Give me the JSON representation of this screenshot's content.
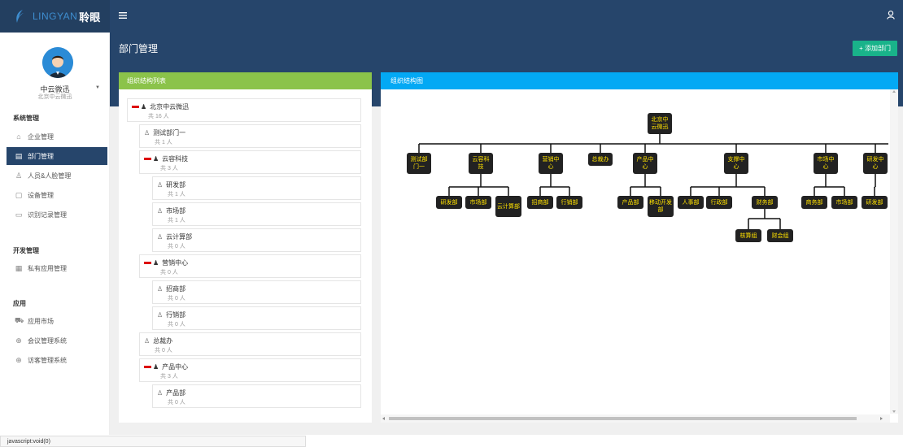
{
  "brand": {
    "en": "LINGYAN",
    "cn": "聆眼",
    "logo_icon": "feather-logo-icon"
  },
  "topbar": {
    "menu_icon": "hamburger-icon",
    "user_icon": "user-icon"
  },
  "user": {
    "name": "中云微迅",
    "org": "北京中云微迅",
    "caret": "▼"
  },
  "sidebar": {
    "sections": [
      {
        "title": "系统管理",
        "items": [
          {
            "label": "企业管理",
            "icon": "home-icon",
            "glyph": "⌂"
          },
          {
            "label": "部门管理",
            "icon": "department-icon",
            "glyph": "▤",
            "active": true
          },
          {
            "label": "人员&人脸管理",
            "icon": "person-icon",
            "glyph": "♙"
          },
          {
            "label": "设备管理",
            "icon": "device-icon",
            "glyph": "▢"
          },
          {
            "label": "识别记录管理",
            "icon": "record-icon",
            "glyph": "▭"
          }
        ]
      },
      {
        "title": "开发管理",
        "items": [
          {
            "label": "私有应用管理",
            "icon": "apps-grid-icon",
            "glyph": "▦"
          }
        ]
      },
      {
        "title": "应用",
        "items": [
          {
            "label": "应用市场",
            "icon": "cart-icon",
            "glyph": "⛟"
          },
          {
            "label": "会议管理系统",
            "icon": "box-icon",
            "glyph": "⊕"
          },
          {
            "label": "访客管理系统",
            "icon": "box-icon",
            "glyph": "⊕"
          }
        ]
      }
    ]
  },
  "page": {
    "title": "部门管理",
    "add_button": "+ 添加部门"
  },
  "left_panel": {
    "title": "组织结构列表"
  },
  "right_panel": {
    "title": "组织结构图"
  },
  "tree": [
    {
      "name": "北京中云微迅",
      "count": "共 16 人",
      "level": 0,
      "group": true
    },
    {
      "name": "测试部门一",
      "count": "共 1 人",
      "level": 1,
      "group": false
    },
    {
      "name": "云容科技",
      "count": "共 3 人",
      "level": 1,
      "group": true
    },
    {
      "name": "研发部",
      "count": "共 1 人",
      "level": 2,
      "group": false
    },
    {
      "name": "市场部",
      "count": "共 1 人",
      "level": 2,
      "group": false
    },
    {
      "name": "云计算部",
      "count": "共 0 人",
      "level": 2,
      "group": false
    },
    {
      "name": "营销中心",
      "count": "共 0 人",
      "level": 1,
      "group": true
    },
    {
      "name": "招商部",
      "count": "共 0 人",
      "level": 2,
      "group": false
    },
    {
      "name": "行销部",
      "count": "共 0 人",
      "level": 2,
      "group": false
    },
    {
      "name": "总裁办",
      "count": "共 0 人",
      "level": 1,
      "group": false
    },
    {
      "name": "产品中心",
      "count": "共 3 人",
      "level": 1,
      "group": true
    },
    {
      "name": "产品部",
      "count": "共 0 人",
      "level": 2,
      "group": false
    }
  ],
  "org_chart": {
    "root": "北京中云微迅",
    "children": [
      {
        "name": "测试部门一",
        "children": []
      },
      {
        "name": "云容科技",
        "children": [
          {
            "name": "研发部"
          },
          {
            "name": "市场部"
          },
          {
            "name": "云计算部"
          }
        ]
      },
      {
        "name": "营销中心",
        "children": [
          {
            "name": "招商部"
          },
          {
            "name": "行销部"
          }
        ]
      },
      {
        "name": "总裁办",
        "children": []
      },
      {
        "name": "产品中心",
        "children": [
          {
            "name": "产品部"
          },
          {
            "name": "移动开发部"
          }
        ]
      },
      {
        "name": "支撑中心",
        "children": [
          {
            "name": "人事部"
          },
          {
            "name": "行政部"
          },
          {
            "name": "财务部",
            "children": [
              {
                "name": "核算组"
              },
              {
                "name": "财会组"
              }
            ]
          }
        ]
      },
      {
        "name": "市场中心",
        "children": [
          {
            "name": "商务部"
          },
          {
            "name": "市场部"
          }
        ]
      },
      {
        "name": "研发中心",
        "children": [
          {
            "name": "研发部"
          }
        ]
      }
    ]
  },
  "status_bar": "javascript:void(0)"
}
